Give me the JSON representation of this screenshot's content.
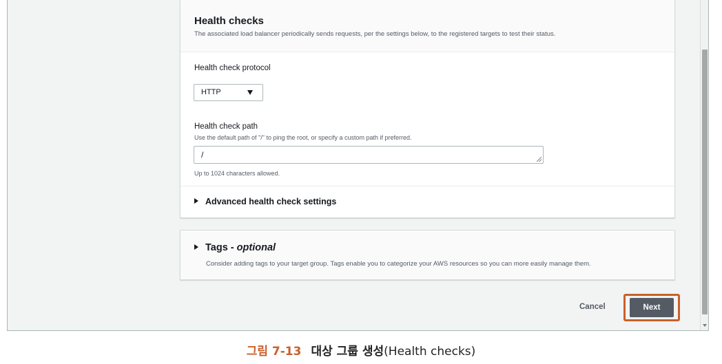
{
  "health_checks": {
    "title": "Health checks",
    "description": "The associated load balancer periodically sends requests, per the settings below, to the registered targets to test their status.",
    "protocol_label": "Health check protocol",
    "protocol_value": "HTTP",
    "path_label": "Health check path",
    "path_description": "Use the default path of \"/\" to ping the root, or specify a custom path if preferred.",
    "path_value": "/",
    "path_constraint": "Up to 1024 characters allowed.",
    "advanced_label": "Advanced health check settings"
  },
  "tags": {
    "title": "Tags - ",
    "title_optional": "optional",
    "description": "Consider adding tags to your target group. Tags enable you to categorize your AWS resources so you can more easily manage them."
  },
  "footer": {
    "cancel_label": "Cancel",
    "next_label": "Next"
  },
  "caption": {
    "figure_number": "그림 7-13",
    "title_korean": "대상 그룹 생성",
    "title_english": "(Health checks)"
  },
  "colors": {
    "highlight": "#c8602a",
    "primary_button": "#545b64"
  }
}
